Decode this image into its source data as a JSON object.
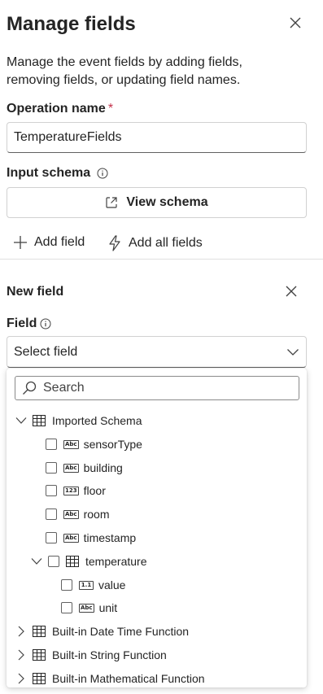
{
  "header": {
    "title": "Manage fields"
  },
  "description": "Manage the event fields by adding fields, removing fields, or updating field names.",
  "operation": {
    "label": "Operation name",
    "required_mark": "*",
    "value": "TemperatureFields"
  },
  "schema": {
    "label": "Input schema",
    "button_label": "View schema"
  },
  "actions": {
    "add_field": "Add field",
    "add_all_fields": "Add all fields"
  },
  "new_field": {
    "title": "New field",
    "field_label": "Field",
    "dropdown_placeholder": "Select field",
    "search_placeholder": "Search"
  },
  "tree": {
    "imported": {
      "label": "Imported Schema",
      "children": [
        {
          "label": "sensorType",
          "type": "Abc"
        },
        {
          "label": "building",
          "type": "Abc"
        },
        {
          "label": "floor",
          "type": "123"
        },
        {
          "label": "room",
          "type": "Abc"
        },
        {
          "label": "timestamp",
          "type": "Abc"
        }
      ],
      "temperature": {
        "label": "temperature",
        "children": [
          {
            "label": "value",
            "type": "1.1"
          },
          {
            "label": "unit",
            "type": "Abc"
          }
        ]
      }
    },
    "builtins": [
      {
        "label": "Built-in Date Time Function"
      },
      {
        "label": "Built-in String Function"
      },
      {
        "label": "Built-in Mathematical Function"
      }
    ]
  },
  "colors": {
    "text": "#242424",
    "required": "#c4314b",
    "border": "#d1d1d1"
  }
}
